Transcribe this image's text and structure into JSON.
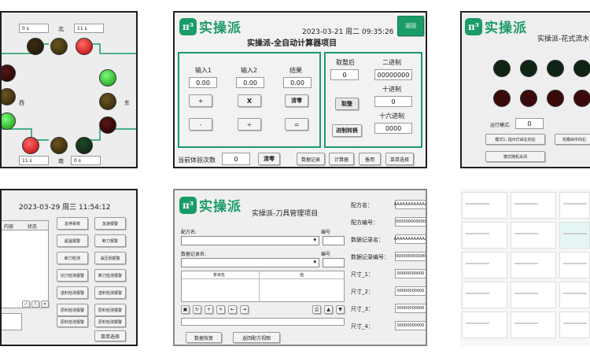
{
  "brand": {
    "name": "实操派",
    "badge": "π³"
  },
  "panel1": {
    "labels": [
      "北",
      "西",
      "东",
      "南"
    ],
    "timer_fields": [
      "0 s",
      "11 s",
      "11 s",
      "0 s"
    ]
  },
  "panel2": {
    "datetime": "2023-03-21 周二 09:35:26",
    "title": "实操派-全自动计算器项目",
    "corner_button": "返回",
    "input1_label": "输入1",
    "input2_label": "输入2",
    "result_label": "结果",
    "input1_value": "0.00",
    "input2_value": "0.00",
    "result_value": "0.00",
    "ops": [
      "+",
      "X",
      "-",
      "÷"
    ],
    "clear_label": "清零",
    "equals_label": "=",
    "convert_before_label": "取整后",
    "convert_before_value": "0",
    "binary_label": "二进制",
    "binary_value": "00000000",
    "decimal_label": "十进制",
    "decimal_value": "0",
    "hex_label": "十六进制",
    "hex_value": "0000",
    "round_button": "取整",
    "convert_button": "进制转换",
    "count_label": "当前体验次数",
    "count_value": "0",
    "count_clear": "清零",
    "footer_buttons": [
      "数据记录",
      "计算器",
      "备用",
      "菜单选择"
    ]
  },
  "panel3": {
    "title": "实操派-花式流水",
    "mode_label": "运行模式:",
    "mode_value": "0",
    "btn_left": "模式1: 指示灯由左向右",
    "btn_right": "花瓣由中向右",
    "btn_off": "模式随机关闭"
  },
  "panel4": {
    "datetime": "2023-03-29 周三 11:54:12",
    "col_headers": [
      "内容",
      "状态"
    ],
    "buttons": [
      [
        "急停系统",
        "急速报警"
      ],
      [
        "超温报警",
        "断刀报警"
      ],
      [
        "断刀检测",
        "油压低报警"
      ],
      [
        "切刀检测报警",
        "断刀检测报警"
      ],
      [
        "送料检测报警",
        "送料检测报警"
      ],
      [
        "原料检测报警",
        "原料检测报警"
      ],
      [
        "原料检测报警",
        "原料检测报警"
      ]
    ],
    "menu_button": "菜单选择"
  },
  "panel5": {
    "title": "实操派-刀具管理项目",
    "formula_label": "配方名:",
    "data_record_label": "数据记录名:",
    "id_label": "编号",
    "col_headers": [
      "条目名",
      "值"
    ],
    "right_labels": [
      "配方名：",
      "配方编号：",
      "数据记录名：",
      "数据记录编号：",
      "尺寸_1：",
      "尺寸_2：",
      "尺寸_3：",
      "尺寸_4："
    ],
    "right_values": [
      "AAAAAAAAAAAA",
      "000000000000",
      "AAAAAAAAAAAA",
      "000000000000",
      "00000000000",
      "00000000000",
      "00000000000",
      "00000000000"
    ],
    "btn_load": "数据恢复",
    "btn_back": "返回配方视图"
  }
}
